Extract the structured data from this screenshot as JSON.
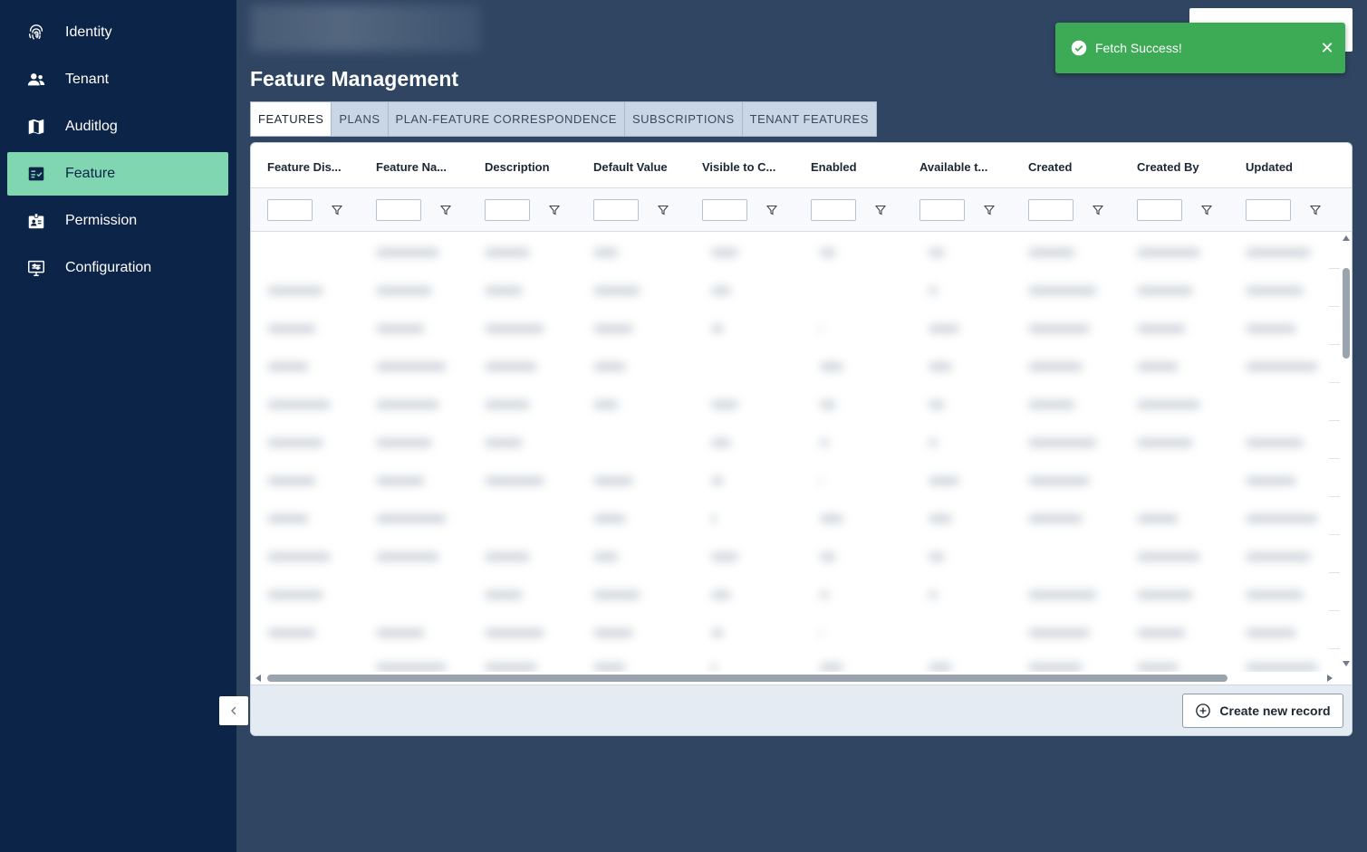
{
  "sidebar": {
    "items": [
      {
        "label": "Identity",
        "icon": "fingerprint-icon",
        "active": false
      },
      {
        "label": "Tenant",
        "icon": "people-icon",
        "active": false
      },
      {
        "label": "Auditlog",
        "icon": "map-icon",
        "active": false
      },
      {
        "label": "Feature",
        "icon": "checklist-icon",
        "active": true
      },
      {
        "label": "Permission",
        "icon": "badge-icon",
        "active": false
      },
      {
        "label": "Configuration",
        "icon": "settings-monitor-icon",
        "active": false
      }
    ],
    "collapse_icon": "chevron-left-icon"
  },
  "header": {
    "page_title": "Feature Management"
  },
  "toast": {
    "message": "Fetch Success!",
    "close_glyph": "✕",
    "status_color": "#3daa55"
  },
  "tabs": [
    {
      "label": "FEATURES",
      "active": true
    },
    {
      "label": "PLANS",
      "active": false
    },
    {
      "label": "PLAN-FEATURE CORRESPONDENCE",
      "active": false
    },
    {
      "label": "SUBSCRIPTIONS",
      "active": false
    },
    {
      "label": "TENANT FEATURES",
      "active": false
    }
  ],
  "grid": {
    "columns": [
      "Feature Dis...",
      "Feature Na...",
      "Description",
      "Default Value",
      "Visible to C...",
      "Enabled",
      "Available t...",
      "Created",
      "Created By",
      "Updated"
    ],
    "filter_icon": "filter-icon",
    "rows_blurred": true
  },
  "footer": {
    "create_label": "Create new record",
    "create_icon": "plus-circle-icon"
  },
  "colors": {
    "sidebar_bg": "#0b2447",
    "active_nav": "#7fd6b0",
    "main_bg": "#2f4562"
  }
}
